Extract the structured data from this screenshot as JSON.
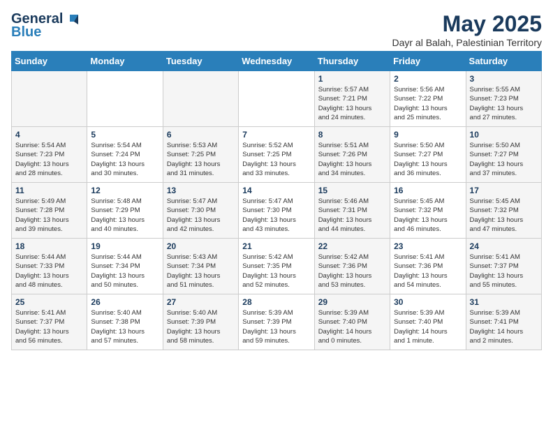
{
  "header": {
    "logo_general": "General",
    "logo_blue": "Blue",
    "title": "May 2025",
    "location": "Dayr al Balah, Palestinian Territory"
  },
  "days_of_week": [
    "Sunday",
    "Monday",
    "Tuesday",
    "Wednesday",
    "Thursday",
    "Friday",
    "Saturday"
  ],
  "weeks": [
    {
      "cells": [
        {
          "day": "",
          "info": ""
        },
        {
          "day": "",
          "info": ""
        },
        {
          "day": "",
          "info": ""
        },
        {
          "day": "",
          "info": ""
        },
        {
          "day": "1",
          "info": "Sunrise: 5:57 AM\nSunset: 7:21 PM\nDaylight: 13 hours\nand 24 minutes."
        },
        {
          "day": "2",
          "info": "Sunrise: 5:56 AM\nSunset: 7:22 PM\nDaylight: 13 hours\nand 25 minutes."
        },
        {
          "day": "3",
          "info": "Sunrise: 5:55 AM\nSunset: 7:23 PM\nDaylight: 13 hours\nand 27 minutes."
        }
      ]
    },
    {
      "cells": [
        {
          "day": "4",
          "info": "Sunrise: 5:54 AM\nSunset: 7:23 PM\nDaylight: 13 hours\nand 28 minutes."
        },
        {
          "day": "5",
          "info": "Sunrise: 5:54 AM\nSunset: 7:24 PM\nDaylight: 13 hours\nand 30 minutes."
        },
        {
          "day": "6",
          "info": "Sunrise: 5:53 AM\nSunset: 7:25 PM\nDaylight: 13 hours\nand 31 minutes."
        },
        {
          "day": "7",
          "info": "Sunrise: 5:52 AM\nSunset: 7:25 PM\nDaylight: 13 hours\nand 33 minutes."
        },
        {
          "day": "8",
          "info": "Sunrise: 5:51 AM\nSunset: 7:26 PM\nDaylight: 13 hours\nand 34 minutes."
        },
        {
          "day": "9",
          "info": "Sunrise: 5:50 AM\nSunset: 7:27 PM\nDaylight: 13 hours\nand 36 minutes."
        },
        {
          "day": "10",
          "info": "Sunrise: 5:50 AM\nSunset: 7:27 PM\nDaylight: 13 hours\nand 37 minutes."
        }
      ]
    },
    {
      "cells": [
        {
          "day": "11",
          "info": "Sunrise: 5:49 AM\nSunset: 7:28 PM\nDaylight: 13 hours\nand 39 minutes."
        },
        {
          "day": "12",
          "info": "Sunrise: 5:48 AM\nSunset: 7:29 PM\nDaylight: 13 hours\nand 40 minutes."
        },
        {
          "day": "13",
          "info": "Sunrise: 5:47 AM\nSunset: 7:30 PM\nDaylight: 13 hours\nand 42 minutes."
        },
        {
          "day": "14",
          "info": "Sunrise: 5:47 AM\nSunset: 7:30 PM\nDaylight: 13 hours\nand 43 minutes."
        },
        {
          "day": "15",
          "info": "Sunrise: 5:46 AM\nSunset: 7:31 PM\nDaylight: 13 hours\nand 44 minutes."
        },
        {
          "day": "16",
          "info": "Sunrise: 5:45 AM\nSunset: 7:32 PM\nDaylight: 13 hours\nand 46 minutes."
        },
        {
          "day": "17",
          "info": "Sunrise: 5:45 AM\nSunset: 7:32 PM\nDaylight: 13 hours\nand 47 minutes."
        }
      ]
    },
    {
      "cells": [
        {
          "day": "18",
          "info": "Sunrise: 5:44 AM\nSunset: 7:33 PM\nDaylight: 13 hours\nand 48 minutes."
        },
        {
          "day": "19",
          "info": "Sunrise: 5:44 AM\nSunset: 7:34 PM\nDaylight: 13 hours\nand 50 minutes."
        },
        {
          "day": "20",
          "info": "Sunrise: 5:43 AM\nSunset: 7:34 PM\nDaylight: 13 hours\nand 51 minutes."
        },
        {
          "day": "21",
          "info": "Sunrise: 5:42 AM\nSunset: 7:35 PM\nDaylight: 13 hours\nand 52 minutes."
        },
        {
          "day": "22",
          "info": "Sunrise: 5:42 AM\nSunset: 7:36 PM\nDaylight: 13 hours\nand 53 minutes."
        },
        {
          "day": "23",
          "info": "Sunrise: 5:41 AM\nSunset: 7:36 PM\nDaylight: 13 hours\nand 54 minutes."
        },
        {
          "day": "24",
          "info": "Sunrise: 5:41 AM\nSunset: 7:37 PM\nDaylight: 13 hours\nand 55 minutes."
        }
      ]
    },
    {
      "cells": [
        {
          "day": "25",
          "info": "Sunrise: 5:41 AM\nSunset: 7:37 PM\nDaylight: 13 hours\nand 56 minutes."
        },
        {
          "day": "26",
          "info": "Sunrise: 5:40 AM\nSunset: 7:38 PM\nDaylight: 13 hours\nand 57 minutes."
        },
        {
          "day": "27",
          "info": "Sunrise: 5:40 AM\nSunset: 7:39 PM\nDaylight: 13 hours\nand 58 minutes."
        },
        {
          "day": "28",
          "info": "Sunrise: 5:39 AM\nSunset: 7:39 PM\nDaylight: 13 hours\nand 59 minutes."
        },
        {
          "day": "29",
          "info": "Sunrise: 5:39 AM\nSunset: 7:40 PM\nDaylight: 14 hours\nand 0 minutes."
        },
        {
          "day": "30",
          "info": "Sunrise: 5:39 AM\nSunset: 7:40 PM\nDaylight: 14 hours\nand 1 minute."
        },
        {
          "day": "31",
          "info": "Sunrise: 5:39 AM\nSunset: 7:41 PM\nDaylight: 14 hours\nand 2 minutes."
        }
      ]
    }
  ]
}
